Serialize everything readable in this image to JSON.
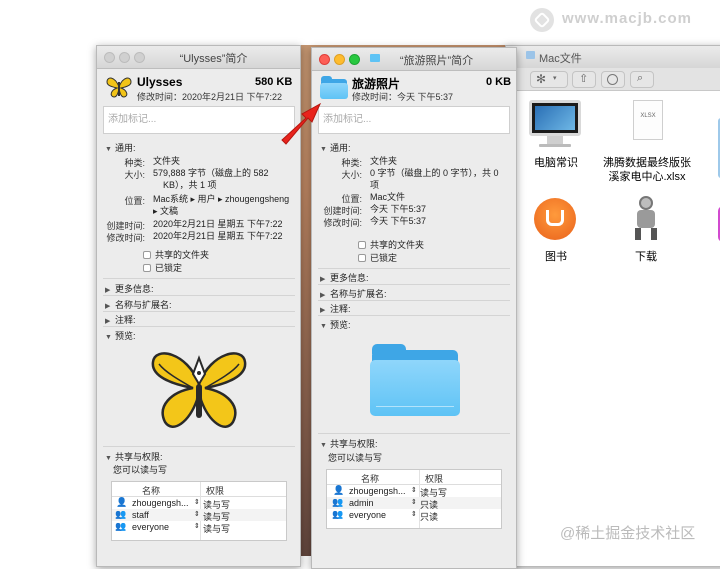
{
  "watermark": {
    "site": "www.macjb.com",
    "footer": "@稀土掘金技术社区"
  },
  "ulysses_info": {
    "title": "“Ulysses”简介",
    "file_name": "Ulysses",
    "size": "580 KB",
    "modified": "修改时间：2020年2月21日 下午7:22",
    "tag_placeholder": "添加标记...",
    "general_header": "通用:",
    "general": {
      "kind_label": "种类:",
      "kind": "文件夹",
      "size_label": "大小:",
      "size_line1": "579,888 字节（磁盘上的 582",
      "size_line2": "KB），共 1 项",
      "where_label": "位置:",
      "where_line1": "Mac系统 ▸ 用户 ▸ zhougengsheng",
      "where_line2": "▸ 文稿",
      "created_label": "创建时间:",
      "created": "2020年2月21日 星期五 下午7:22",
      "modified_label": "修改时间:",
      "modified": "2020年2月21日 星期五 下午7:22"
    },
    "shared_folder": "共享的文件夹",
    "locked": "已锁定",
    "more_info": "更多信息:",
    "name_ext": "名称与扩展名:",
    "comments": "注释:",
    "preview": "预览:",
    "sharing": "共享与权限:",
    "you_can": "您可以读与写",
    "col_name": "名称",
    "col_priv": "权限",
    "perms": [
      {
        "name": "zhougengsh...",
        "priv": "读与写"
      },
      {
        "name": "staff",
        "priv": "读与写"
      },
      {
        "name": "everyone",
        "priv": "读与写"
      }
    ]
  },
  "travel_info": {
    "title": "“旅游照片”简介",
    "file_name": "旅游照片",
    "size": "0 KB",
    "modified": "修改时间：今天 下午5:37",
    "tag_placeholder": "添加标记...",
    "general_header": "通用:",
    "general": {
      "kind_label": "种类:",
      "kind": "文件夹",
      "size_label": "大小:",
      "size_line1": "0 字节（磁盘上的 0 字节），共 0",
      "size_line2": "项",
      "where_label": "位置:",
      "where": "Mac文件",
      "created_label": "创建时间:",
      "created": "今天 下午5:37",
      "modified_label": "修改时间:",
      "modified": "今天 下午5:37"
    },
    "shared_folder": "共享的文件夹",
    "locked": "已锁定",
    "more_info": "更多信息:",
    "name_ext": "名称与扩展名:",
    "comments": "注释:",
    "preview": "预览:",
    "sharing": "共享与权限:",
    "you_can": "您可以读与写",
    "col_name": "名称",
    "col_priv": "权限",
    "perms": [
      {
        "name": "zhougengsh...",
        "priv": "读与写"
      },
      {
        "name": "admin",
        "priv": "只读"
      },
      {
        "name": "everyone",
        "priv": "只读"
      }
    ]
  },
  "finder": {
    "tab_title": "Mac文件",
    "items": [
      {
        "label": "电脑常识"
      },
      {
        "label_line1": "沸腾数据最终版张",
        "label_line2": "溪家电中心.xlsx",
        "badge": "XLSX"
      },
      {
        "label": "图书"
      },
      {
        "label": "下载"
      }
    ]
  },
  "colors": {
    "accent_folder": "#5ec3f5",
    "arrow": "#e8231c"
  }
}
